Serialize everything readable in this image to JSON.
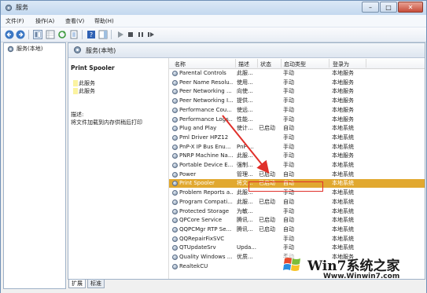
{
  "window": {
    "title": "服务",
    "controls": [
      "–",
      "□",
      "✕"
    ]
  },
  "menu": [
    "文件(F)",
    "操作(A)",
    "查看(V)",
    "帮助(H)"
  ],
  "nav": {
    "item": "服务(本地)"
  },
  "content": {
    "header": "服务(本地)",
    "description": {
      "service_name": "Print Spooler",
      "stop_link": "此服务",
      "restart_link": "此服务",
      "label": "描述:",
      "text": "将文件加载到内存供稍后打印"
    },
    "columns": [
      "名称",
      "描述",
      "状态",
      "启动类型",
      "登录为"
    ],
    "rows": [
      {
        "name": "Parental Controls",
        "desc": "此服...",
        "status": "",
        "start": "手动",
        "logon": "本地服务"
      },
      {
        "name": "Peer Name Resolu...",
        "desc": "使用...",
        "status": "",
        "start": "手动",
        "logon": "本地服务"
      },
      {
        "name": "Peer Networking ...",
        "desc": "向使...",
        "status": "",
        "start": "手动",
        "logon": "本地服务"
      },
      {
        "name": "Peer Networking I...",
        "desc": "提供...",
        "status": "",
        "start": "手动",
        "logon": "本地服务"
      },
      {
        "name": "Performance Cou...",
        "desc": "使远...",
        "status": "",
        "start": "手动",
        "logon": "本地服务"
      },
      {
        "name": "Performance Logs...",
        "desc": "性能...",
        "status": "",
        "start": "手动",
        "logon": "本地服务"
      },
      {
        "name": "Plug and Play",
        "desc": "使计...",
        "status": "已启动",
        "start": "自动",
        "logon": "本地系统"
      },
      {
        "name": "Pml Driver HPZ12",
        "desc": "",
        "status": "",
        "start": "手动",
        "logon": "本地系统"
      },
      {
        "name": "PnP-X IP Bus Enu...",
        "desc": "PnP-...",
        "status": "",
        "start": "手动",
        "logon": "本地系统"
      },
      {
        "name": "PNRP Machine Na...",
        "desc": "此服...",
        "status": "",
        "start": "手动",
        "logon": "本地服务"
      },
      {
        "name": "Portable Device E...",
        "desc": "强制...",
        "status": "",
        "start": "手动",
        "logon": "本地系统"
      },
      {
        "name": "Power",
        "desc": "管理...",
        "status": "已启动",
        "start": "自动",
        "logon": "本地系统"
      },
      {
        "name": "Print Spooler",
        "desc": "将文...",
        "status": "已启动",
        "start": "自动",
        "logon": "本地系统"
      },
      {
        "name": "Problem Reports a...",
        "desc": "此服...",
        "status": "",
        "start": "手动",
        "logon": "本地系统"
      },
      {
        "name": "Program Compati...",
        "desc": "此服...",
        "status": "已启动",
        "start": "自动",
        "logon": "本地系统"
      },
      {
        "name": "Protected Storage",
        "desc": "为敏...",
        "status": "",
        "start": "手动",
        "logon": "本地系统"
      },
      {
        "name": "QPCore Service",
        "desc": "腾讯...",
        "status": "已启动",
        "start": "自动",
        "logon": "本地系统"
      },
      {
        "name": "QQPCMgr RTP Se...",
        "desc": "腾讯...",
        "status": "已启动",
        "start": "自动",
        "logon": "本地系统"
      },
      {
        "name": "QQRepairFixSVC",
        "desc": "",
        "status": "",
        "start": "手动",
        "logon": "本地系统"
      },
      {
        "name": "QTUpdateSrv",
        "desc": "Upda...",
        "status": "",
        "start": "手动",
        "logon": "本地系统"
      },
      {
        "name": "Quality Windows ...",
        "desc": "优质...",
        "status": "",
        "start": "手动",
        "logon": "本地服务"
      },
      {
        "name": "RealtekCU",
        "desc": "",
        "status": "",
        "start": "",
        "logon": ""
      }
    ],
    "selected_index": 12
  },
  "tabs": [
    "扩展",
    "标准"
  ],
  "watermark": {
    "brand": "Win7系统之家",
    "url": "Www.Winwin7.com"
  },
  "colors": {
    "selection": "#e1a82f",
    "highlight_box": "#e0302a"
  }
}
